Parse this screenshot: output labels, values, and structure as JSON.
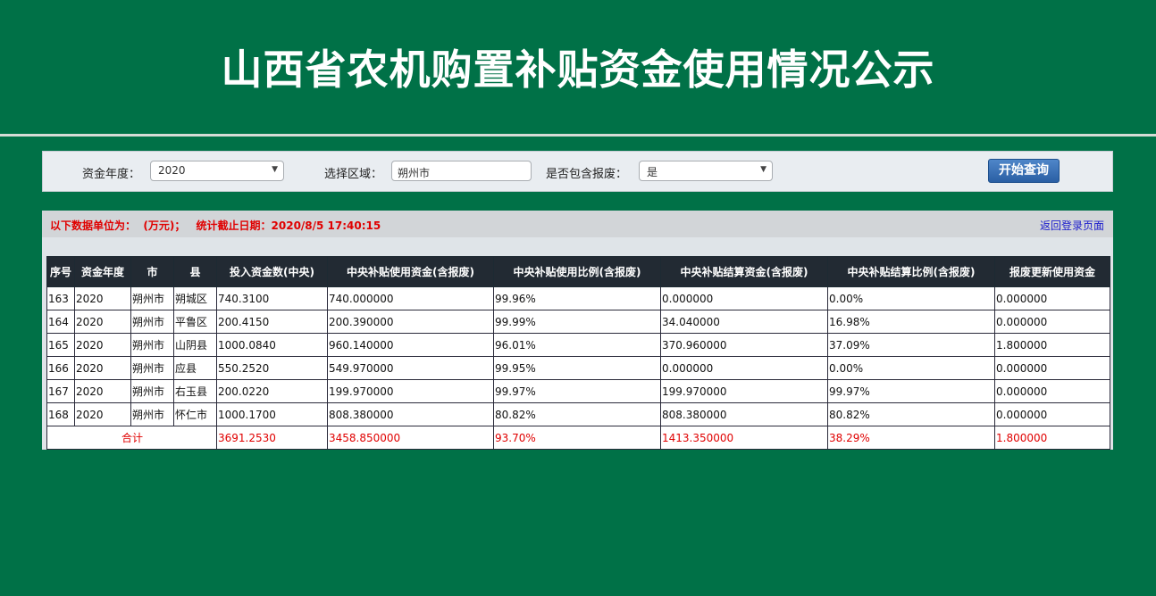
{
  "header": {
    "title": "山西省农机购置补贴资金使用情况公示"
  },
  "filters": {
    "year_label": "资金年度：",
    "year_value": "2020",
    "region_label": "选择区域：",
    "region_value": "朔州市",
    "scrap_label": "是否包含报废：",
    "scrap_value": "是",
    "query_button": "开始查询"
  },
  "info": {
    "unit_text": "以下数据单位为：  (万元)；",
    "date_text": "统计截止日期：2020/8/5 17:40:15",
    "back_link": "返回登录页面"
  },
  "table": {
    "headers": [
      "序号",
      "资金年度",
      "市",
      "县",
      "投入资金数(中央)",
      "中央补贴使用资金(含报废)",
      "中央补贴使用比例(含报废)",
      "中央补贴结算资金(含报废)",
      "中央补贴结算比例(含报废)",
      "报废更新使用资金"
    ],
    "rows": [
      [
        "163",
        "2020",
        "朔州市",
        "朔城区",
        "740.3100",
        "740.000000",
        "99.96%",
        "0.000000",
        "0.00%",
        "0.000000"
      ],
      [
        "164",
        "2020",
        "朔州市",
        "平鲁区",
        "200.4150",
        "200.390000",
        "99.99%",
        "34.040000",
        "16.98%",
        "0.000000"
      ],
      [
        "165",
        "2020",
        "朔州市",
        "山阴县",
        "1000.0840",
        "960.140000",
        "96.01%",
        "370.960000",
        "37.09%",
        "1.800000"
      ],
      [
        "166",
        "2020",
        "朔州市",
        "应县",
        "550.2520",
        "549.970000",
        "99.95%",
        "0.000000",
        "0.00%",
        "0.000000"
      ],
      [
        "167",
        "2020",
        "朔州市",
        "右玉县",
        "200.0220",
        "199.970000",
        "99.97%",
        "199.970000",
        "99.97%",
        "0.000000"
      ],
      [
        "168",
        "2020",
        "朔州市",
        "怀仁市",
        "1000.1700",
        "808.380000",
        "80.82%",
        "808.380000",
        "80.82%",
        "0.000000"
      ]
    ],
    "total": {
      "label": "合计",
      "values": [
        "3691.2530",
        "3458.850000",
        "93.70%",
        "1413.350000",
        "38.29%",
        "1.800000"
      ]
    }
  },
  "colors": {
    "background": "#007147",
    "header_row": "#222a33",
    "total_text": "#e00000"
  }
}
